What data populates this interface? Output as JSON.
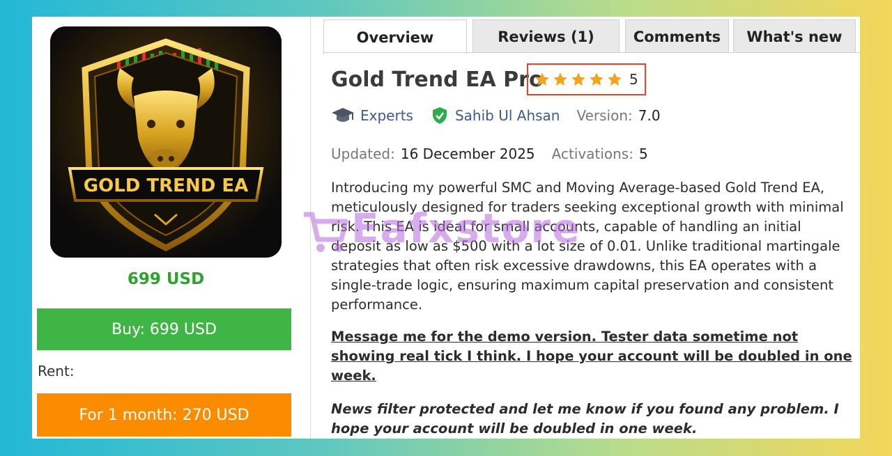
{
  "product": {
    "image_label": "GOLD TREND EA",
    "price": "699 USD",
    "buy_label": "Buy: 699 USD",
    "rent_label": "Rent:",
    "rent_option": "For 1 month: 270 USD"
  },
  "tabs": [
    {
      "label": "Overview",
      "active": true
    },
    {
      "label": "Reviews (1)"
    },
    {
      "label": "Comments"
    },
    {
      "label": "What's new"
    }
  ],
  "title": "Gold Trend EA Pro",
  "rating": {
    "stars": 5,
    "value": "5"
  },
  "meta": {
    "category": "Experts",
    "author": "Sahib Ul Ahsan",
    "version_label": "Version:",
    "version": "7.0",
    "updated_label": "Updated:",
    "updated": "16 December 2025",
    "activations_label": "Activations:",
    "activations": "5"
  },
  "description": "Introducing my powerful SMC and Moving Average-based Gold Trend EA, meticulously designed for traders seeking exceptional growth with minimal risk. This EA is ideal for small accounts, capable of handling an initial deposit as low as $500 with a lot size of 0.01. Unlike traditional martingale strategies that often risk excessive drawdowns, this EA operates with a single-trade logic, ensuring maximum capital preservation and consistent performance.",
  "message": "Message me for the demo version. Tester data sometime not showing real tick I think. I hope your account will be doubled in one week.",
  "news": "News filter protected and let me know if you found any problem. I hope your account will be doubled in one week.",
  "watermark": "Eafxstore",
  "colors": {
    "price": "#2aa52a",
    "buy": "#3eb545",
    "rent": "#fb8c00",
    "star": "#f2a51a",
    "rating_border": "#e2452c",
    "link": "#3e5a8a"
  }
}
